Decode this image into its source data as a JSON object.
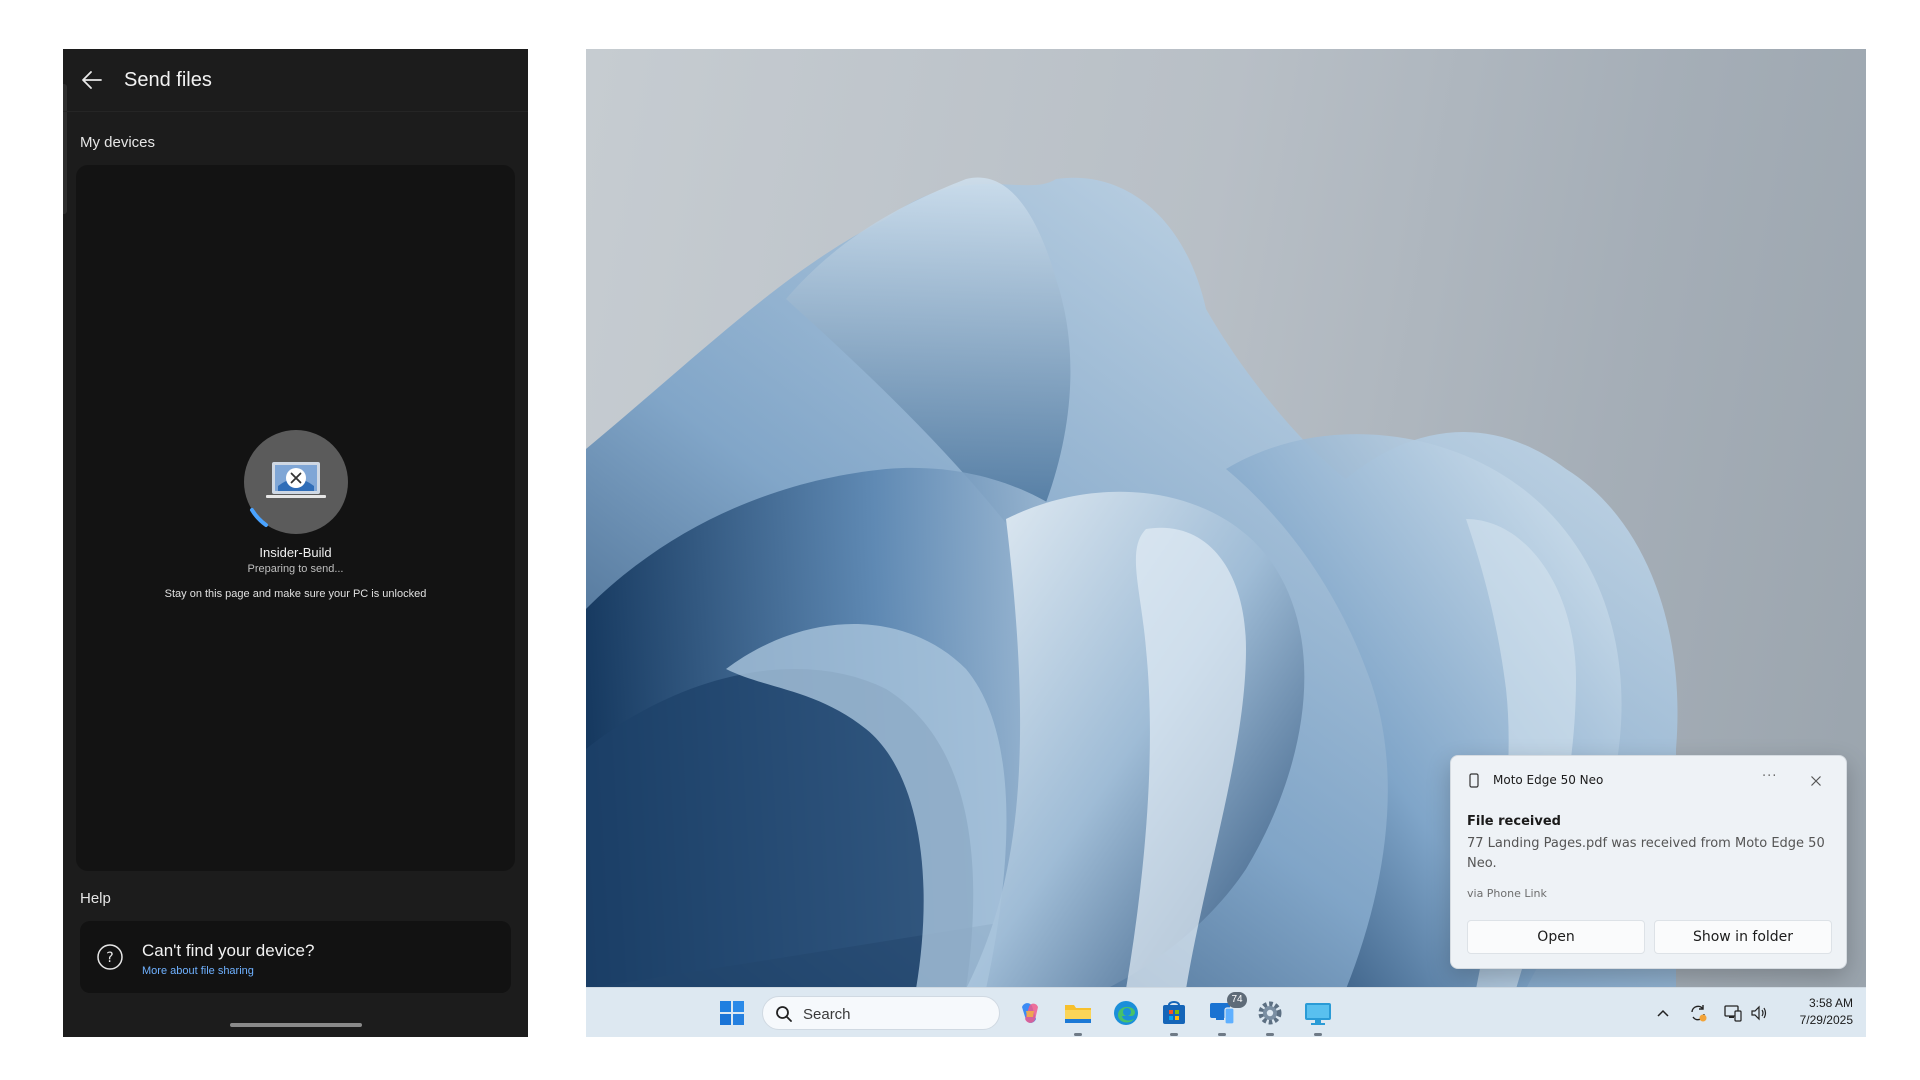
{
  "phone": {
    "title": "Send files",
    "my_devices_label": "My devices",
    "device": {
      "name": "Insider-Build",
      "status": "Preparing to send...",
      "hint": "Stay on this page and make sure your PC is unlocked"
    },
    "help": {
      "label": "Help",
      "title": "Can't find your device?",
      "link": "More about file sharing"
    }
  },
  "notification": {
    "app": "Moto Edge 50 Neo",
    "more": "···",
    "heading": "File received",
    "body": "77 Landing Pages.pdf was received from Moto Edge 50 Neo.",
    "via": "via Phone Link",
    "open_label": "Open",
    "folder_label": "Show in folder"
  },
  "taskbar": {
    "search_placeholder": "Search",
    "badge_count": "74",
    "icons": [
      "windows-start-icon",
      "copilot-icon",
      "file-explorer-icon",
      "edge-icon",
      "store-icon",
      "phone-link-icon",
      "settings-icon",
      "remote-desktop-icon"
    ],
    "tray_icons": [
      "chevron-up-icon",
      "sync-icon",
      "network-icon",
      "volume-icon"
    ],
    "time": "3:58 AM",
    "date": "7/29/2025"
  },
  "colors": {
    "phone_bg": "#1c1c1c",
    "link": "#6fb1ff",
    "taskbar_bg": "#dde8f1",
    "accent": "#0a6cd4"
  }
}
